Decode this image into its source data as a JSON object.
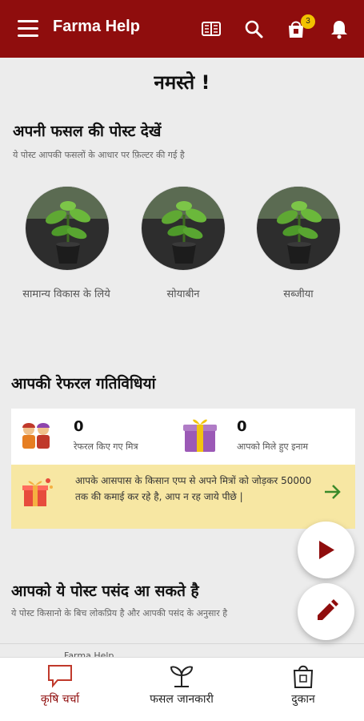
{
  "app": {
    "title": "Farma Help",
    "cart_badge": "3",
    "accent": "#8f0d0d"
  },
  "greeting": "नमस्ते !",
  "crop_section": {
    "title": "अपनी फसल की पोस्ट देखें",
    "subtitle": "ये पोस्ट आपकी फसलों के आधार पर फ़िल्टर की गई है",
    "items": [
      {
        "label": "सामान्य विकास के लिये"
      },
      {
        "label": "सोयाबीन"
      },
      {
        "label": "सब्जीया"
      }
    ]
  },
  "referral_section": {
    "title": "आपकी रेफरल गतिविधियां",
    "friends_count": "0",
    "friends_label": "रेफरल किए गए मित्र",
    "rewards_count": "0",
    "rewards_label": "आपको मिले हुए इनाम",
    "promo_text": "आपके आसपास के किसान एप्प से अपने मित्रों को जोड़कर 50000 तक की कमाई कर रहे है, आप न रह जाये पीछे |"
  },
  "suggested_section": {
    "title": "आपको ये पोस्ट पसंद आ सकते है",
    "subtitle": "ये पोस्ट किसानो के बिच लोकप्रिय है और आपकी पसंद के अनुसार है"
  },
  "peek_author": "Farma Help",
  "bottom_nav": {
    "items": [
      {
        "label": "कृषि चर्चा",
        "active": true
      },
      {
        "label": "फसल जानकारी",
        "active": false
      },
      {
        "label": "दुकान",
        "active": false
      }
    ],
    "active_color": "#8f0d0d"
  },
  "icons": {
    "menu": "hamburger-icon",
    "news": "newspaper-icon",
    "search": "search-icon",
    "cart": "shopping-bag-icon",
    "notifications": "bell-icon",
    "play": "play-icon",
    "edit": "pencil-icon"
  }
}
